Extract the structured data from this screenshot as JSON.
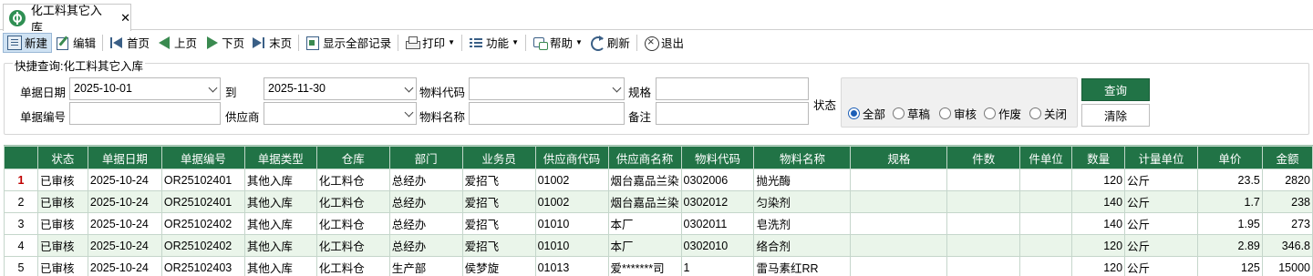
{
  "tab": {
    "title": "化工料其它入库",
    "close": "✕"
  },
  "toolbar": {
    "new": "新建",
    "edit": "编辑",
    "first": "首页",
    "prev": "上页",
    "next": "下页",
    "last": "末页",
    "show_all": "显示全部记录",
    "print": "打印",
    "functions": "功能",
    "help": "帮助",
    "refresh": "刷新",
    "exit": "退出"
  },
  "query": {
    "title": "快捷查询:化工料其它入库",
    "date_label": "单据日期",
    "date_from": "2025-10-01",
    "to_label": "到",
    "date_to": "2025-11-30",
    "material_code_label": "物料代码",
    "material_code": "",
    "spec_label": "规格",
    "spec": "",
    "doc_no_label": "单据编号",
    "doc_no": "",
    "supplier_label": "供应商",
    "supplier": "",
    "material_name_label": "物料名称",
    "material_name": "",
    "remark_label": "备注",
    "remark": "",
    "status_label": "状态",
    "status_options": [
      "全部",
      "草稿",
      "审核",
      "作废",
      "关闭"
    ],
    "status_selected": "全部",
    "query_button": "查询",
    "clear_button": "清除"
  },
  "grid": {
    "columns": [
      "状态",
      "单据日期",
      "单据编号",
      "单据类型",
      "仓库",
      "部门",
      "业务员",
      "供应商代码",
      "供应商名称",
      "物料代码",
      "物料名称",
      "规格",
      "件数",
      "件单位",
      "数量",
      "计量单位",
      "单价",
      "金额"
    ],
    "rows": [
      {
        "no": "1",
        "cells": [
          "已审核",
          "2025-10-24",
          "OR25102401",
          "其他入库",
          "化工料仓",
          "总经办",
          "爱招飞",
          "01002",
          "烟台嘉品兰染",
          "0302006",
          "抛光酶",
          "",
          "",
          "",
          "120",
          "公斤",
          "23.5",
          "2820"
        ]
      },
      {
        "no": "2",
        "cells": [
          "已审核",
          "2025-10-24",
          "OR25102401",
          "其他入库",
          "化工料仓",
          "总经办",
          "爱招飞",
          "01002",
          "烟台嘉品兰染",
          "0302012",
          "匀染剂",
          "",
          "",
          "",
          "140",
          "公斤",
          "1.7",
          "238"
        ]
      },
      {
        "no": "3",
        "cells": [
          "已审核",
          "2025-10-24",
          "OR25102402",
          "其他入库",
          "化工料仓",
          "总经办",
          "爱招飞",
          "01010",
          "本厂",
          "0302011",
          "皂洗剂",
          "",
          "",
          "",
          "140",
          "公斤",
          "1.95",
          "273"
        ]
      },
      {
        "no": "4",
        "cells": [
          "已审核",
          "2025-10-24",
          "OR25102402",
          "其他入库",
          "化工料仓",
          "总经办",
          "爱招飞",
          "01010",
          "本厂",
          "0302010",
          "络合剂",
          "",
          "",
          "",
          "120",
          "公斤",
          "2.89",
          "346.8"
        ]
      },
      {
        "no": "5",
        "cells": [
          "已审核",
          "2025-10-24",
          "OR25102403",
          "其他入库",
          "化工料仓",
          "生产部",
          "侯梦旋",
          "01013",
          "爱*******司",
          "1",
          "雷马素红RR",
          "",
          "",
          "",
          "120",
          "公斤",
          "125",
          "15000"
        ]
      }
    ]
  }
}
